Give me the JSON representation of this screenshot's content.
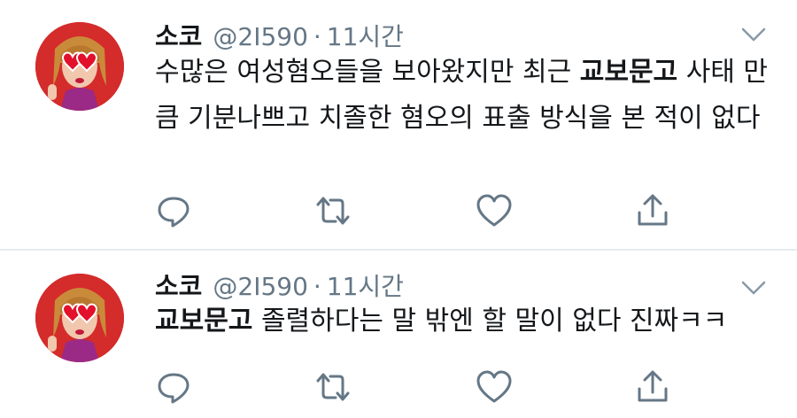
{
  "tweets": [
    {
      "name": "소코",
      "handle": "@2I590",
      "separator": "·",
      "time": "11시간",
      "text_before": "수많은 여성혐오들을 보아왔지만 최근 ",
      "text_bold": "교보문고",
      "text_after": " 사태 만큼 기분나쁘고 치졸한 혐오의 표출 방식을 본 적이 없다"
    },
    {
      "name": "소코",
      "handle": "@2I590",
      "separator": "·",
      "time": "11시간",
      "text_before": "",
      "text_bold": "교보문고",
      "text_after": " 졸렬하다는 말 밖엔 할 말이 없다 진짜ㅋㅋ"
    }
  ],
  "icons": [
    "chevron-down-icon",
    "reply-icon",
    "retweet-icon",
    "like-icon",
    "share-icon"
  ],
  "colors": {
    "muted": "#657786",
    "text": "#14171a",
    "divider": "#e6ecf0",
    "avatar_bg": "#d42b2b"
  }
}
